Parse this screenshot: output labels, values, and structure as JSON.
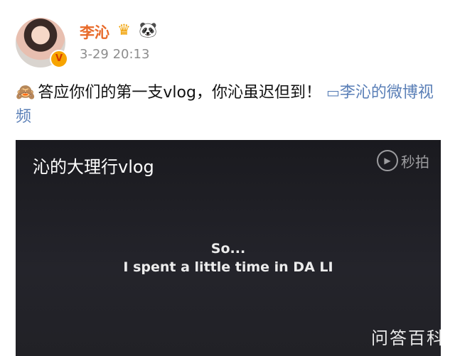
{
  "post": {
    "username": "李沁",
    "crown_icon": "crown-icon",
    "panda_icon": "panda-icon",
    "timestamp": "3-29 20:13",
    "verified_badge": "V",
    "text": "答应你们的第一支vlog，你沁虽迟但到！",
    "link_icon": "video-link-icon",
    "link_text": "李沁的微博视频"
  },
  "video": {
    "title": "沁的大理行vlog",
    "logo_text": "秒拍",
    "subtitle_line1": "So...",
    "subtitle_line2": "I spent a little time in DA LI"
  },
  "watermark": "问答百科",
  "colors": {
    "username": "#e86a29",
    "link": "#5a7fb7",
    "video_bg": "#1f1f24"
  }
}
